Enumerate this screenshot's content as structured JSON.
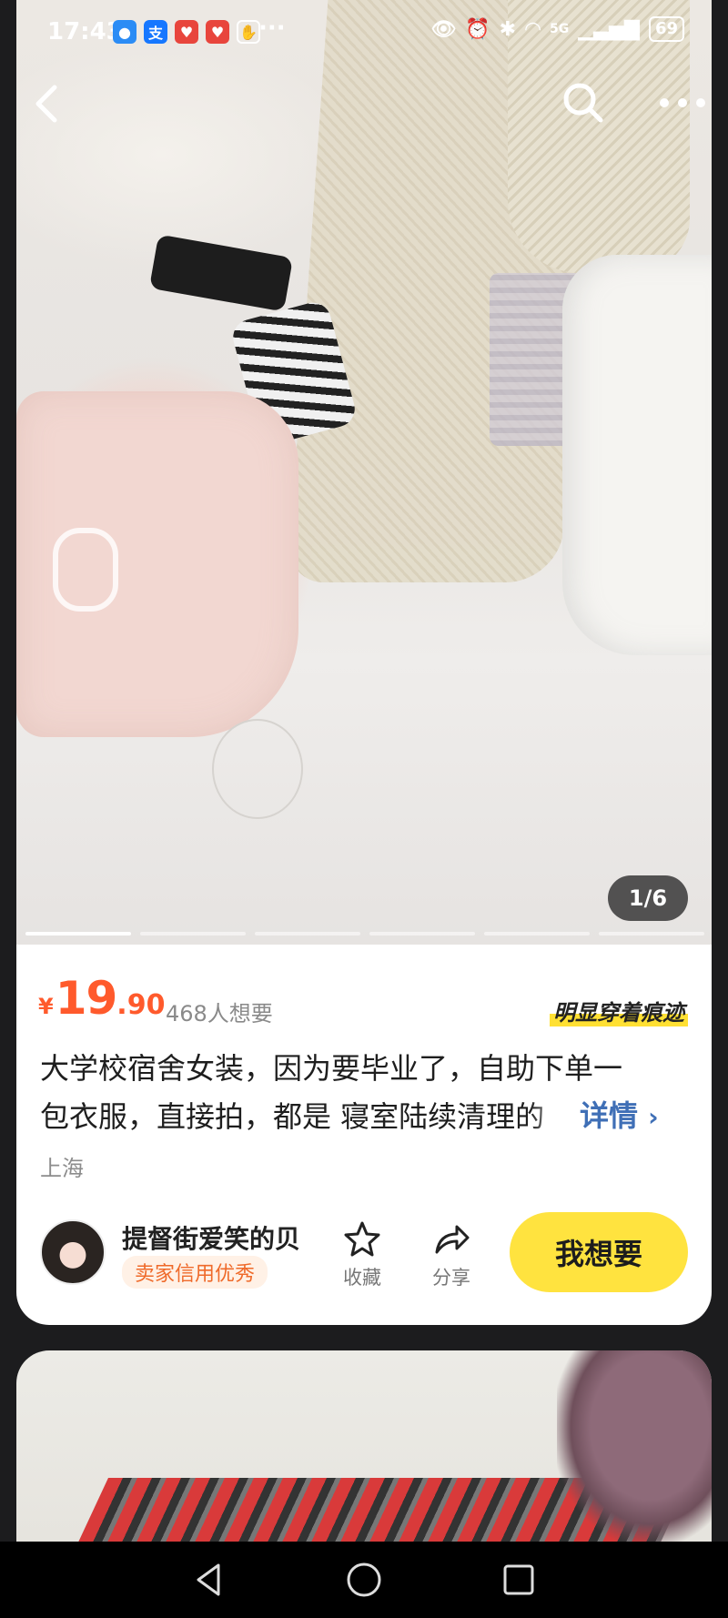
{
  "status_bar": {
    "time": "17:43",
    "notification_icons": [
      "qq-icon",
      "alipay-icon",
      "taobao-618-icon",
      "taobao-618-icon",
      "hand-icon"
    ],
    "more": "···",
    "battery": "69",
    "network": "5G"
  },
  "photo": {
    "pager": "1/6",
    "total_images": 6,
    "current_index": 1
  },
  "product": {
    "price_currency": "¥",
    "price_integer": "19",
    "price_decimal": ".90",
    "wants": "468人想要",
    "condition_tag": "明显穿着痕迹",
    "description_line1": "大学校宿舍女装，因为要毕业了，自助下单一",
    "description_line2": "包衣服，直接拍，都是 寝室陆续清理的",
    "detail_link": "详情",
    "location": "上海"
  },
  "seller": {
    "name": "提督街爱笑的贝",
    "badge": "卖家信用优秀"
  },
  "actions": {
    "favorite": "收藏",
    "share": "分享",
    "want": "我想要"
  },
  "colors": {
    "price": "#ff5a2c",
    "want_button": "#ffe33f",
    "detail_link": "#3f6fb6",
    "badge_text": "#ef6a2a"
  }
}
